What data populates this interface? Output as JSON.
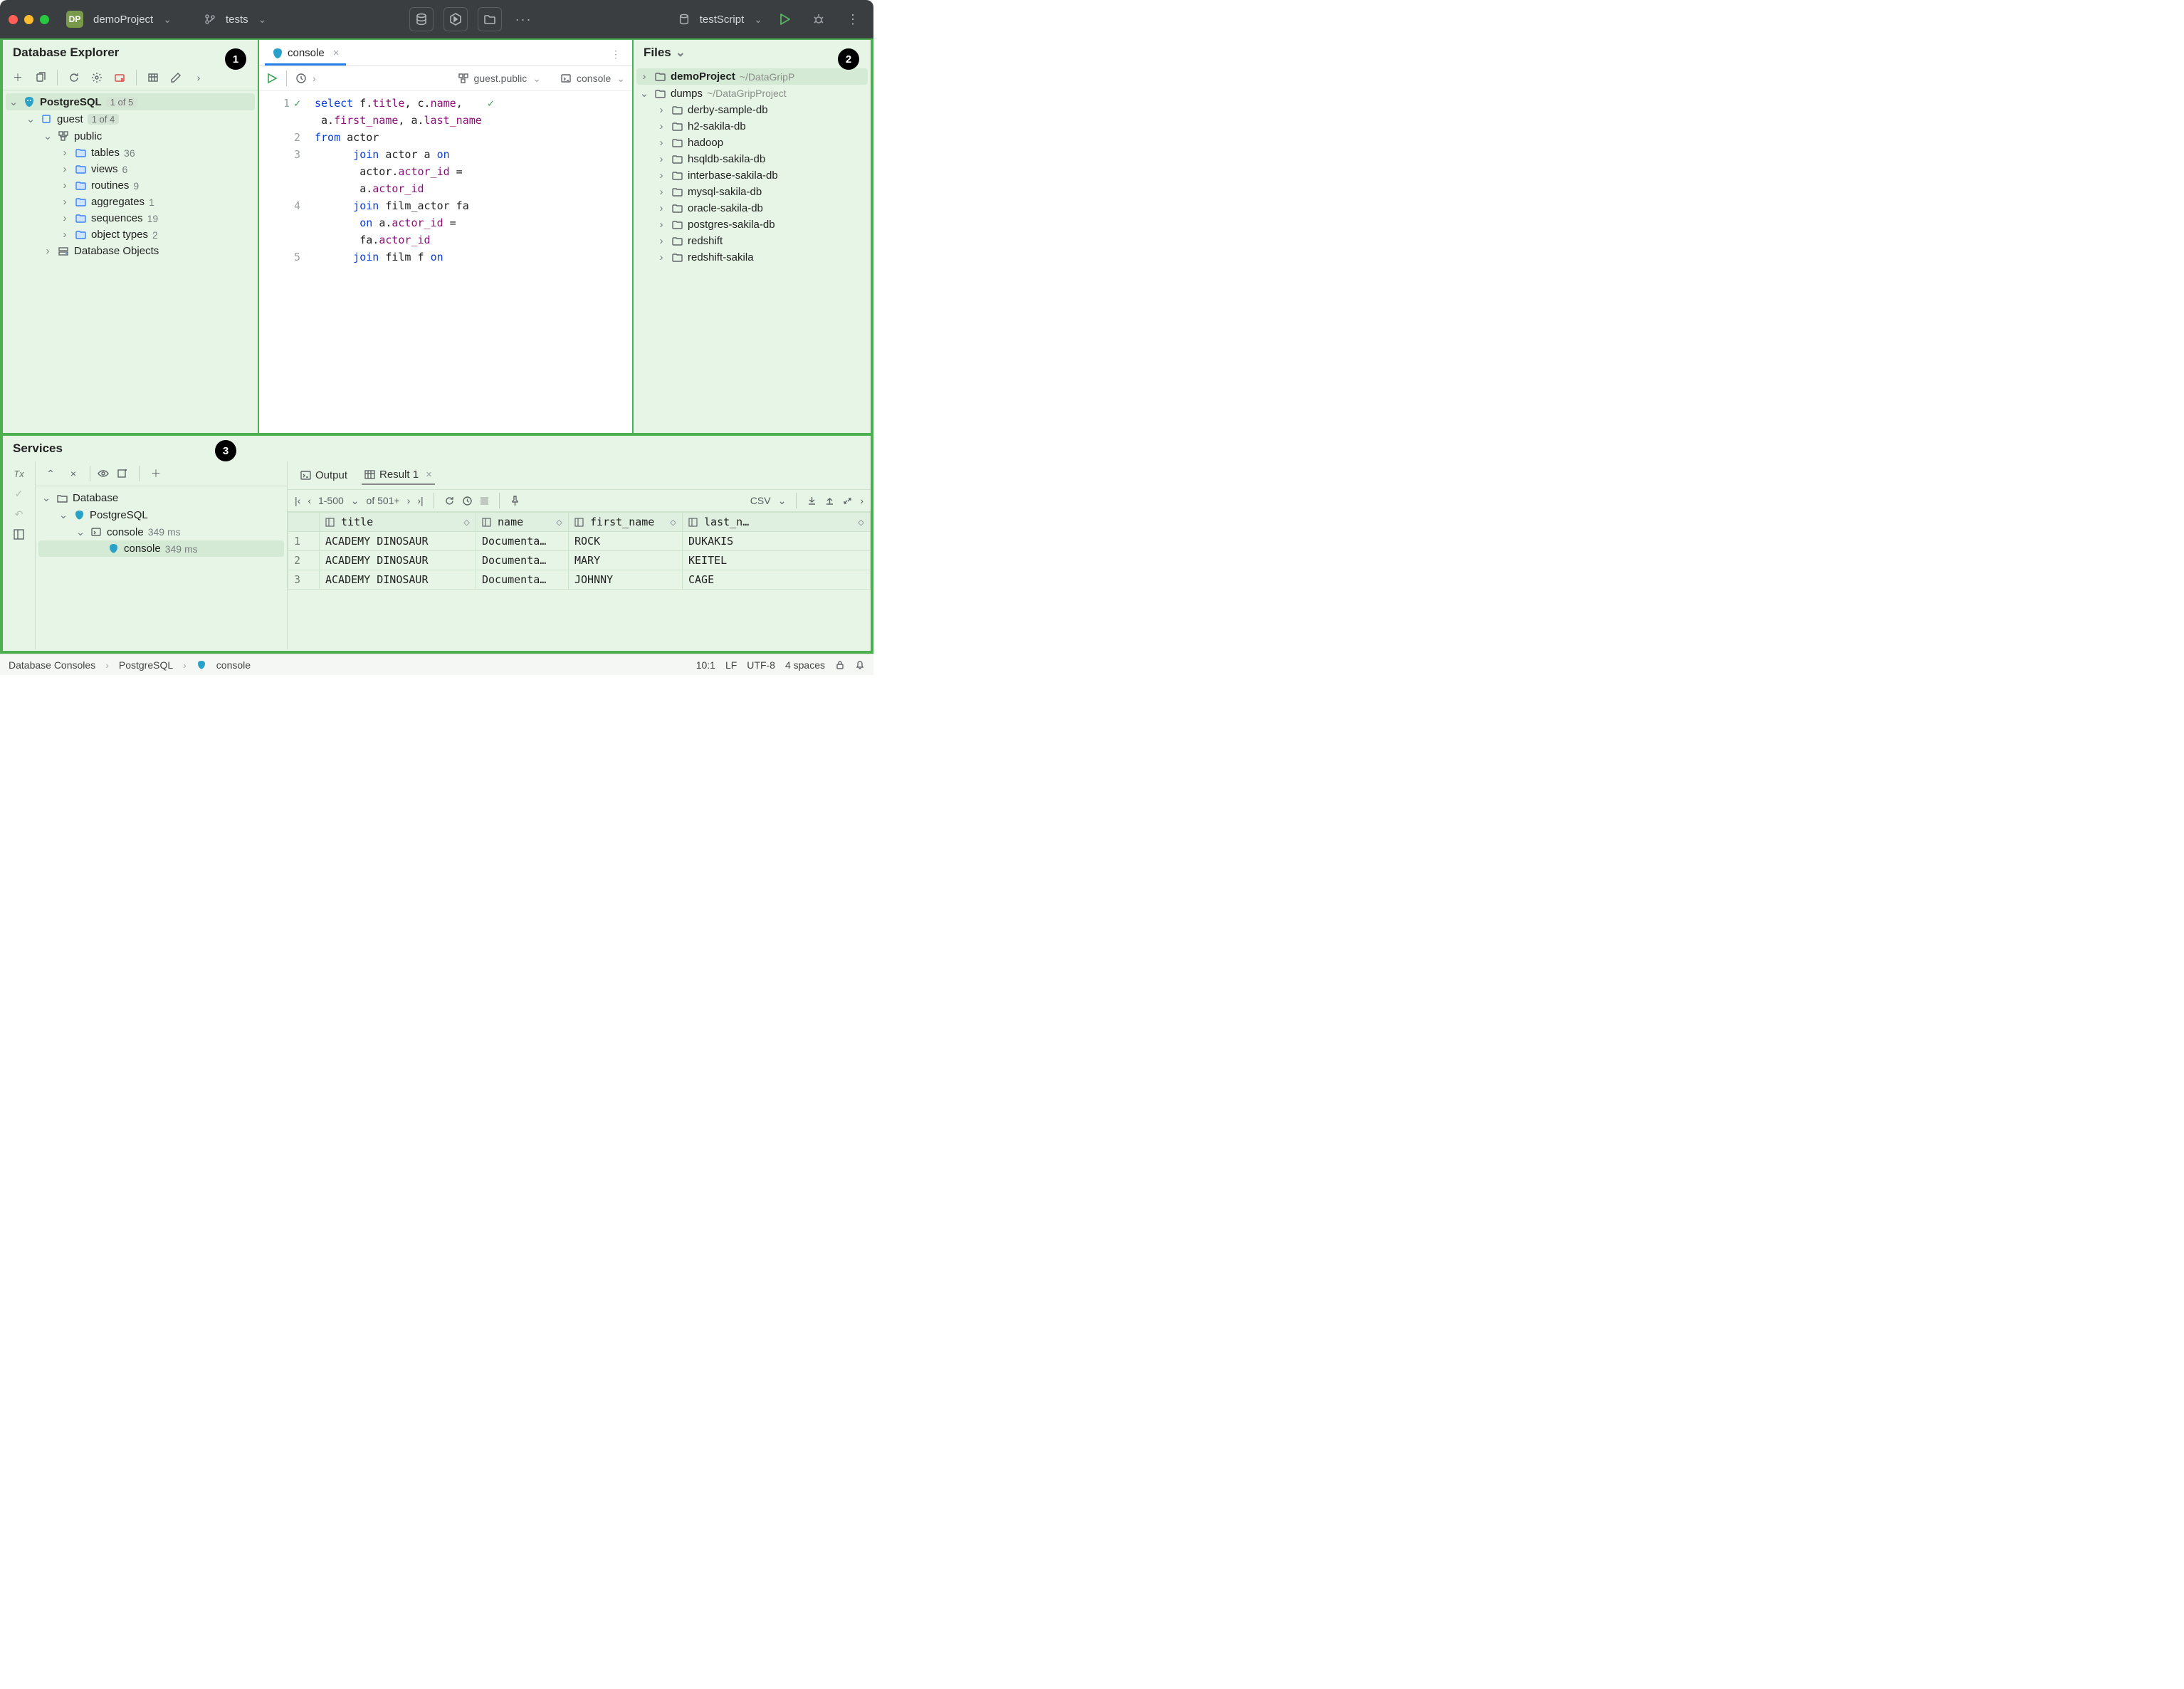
{
  "titlebar": {
    "project_badge": "DP",
    "project_name": "demoProject",
    "branch": "tests",
    "run_config": "testScript"
  },
  "callouts": {
    "db": "1",
    "files": "2",
    "services": "3"
  },
  "db_explorer": {
    "title": "Database Explorer",
    "datasource": "PostgreSQL",
    "datasource_count": "1 of 5",
    "database": "guest",
    "database_count": "1 of 4",
    "schema": "public",
    "nodes": [
      {
        "label": "tables",
        "count": "36"
      },
      {
        "label": "views",
        "count": "6"
      },
      {
        "label": "routines",
        "count": "9"
      },
      {
        "label": "aggregates",
        "count": "1"
      },
      {
        "label": "sequences",
        "count": "19"
      },
      {
        "label": "object types",
        "count": "2"
      }
    ],
    "db_objects": "Database Objects"
  },
  "editor": {
    "tab_label": "console",
    "schema_selector": "guest.public",
    "target_selector": "console",
    "code_lines": [
      {
        "n": "1",
        "txt": [
          "select ",
          "f",
          ".",
          "title",
          ", ",
          "c",
          ".",
          "name",
          ","
        ]
      },
      {
        "n": "",
        "txt": [
          " a",
          ".",
          "first_name",
          ", ",
          "a",
          ".",
          "last_name"
        ]
      },
      {
        "n": "2",
        "txt": [
          "from ",
          "actor"
        ]
      },
      {
        "n": "3",
        "txt": [
          "      join ",
          "actor a ",
          "on"
        ]
      },
      {
        "n": "",
        "txt": [
          "       actor",
          ".",
          "actor_id",
          " ="
        ]
      },
      {
        "n": "",
        "txt": [
          "       a",
          ".",
          "actor_id"
        ]
      },
      {
        "n": "4",
        "txt": [
          "      join ",
          "film_actor fa"
        ]
      },
      {
        "n": "",
        "txt": [
          "       on ",
          "a",
          ".",
          "actor_id",
          " ="
        ]
      },
      {
        "n": "",
        "txt": [
          "       fa",
          ".",
          "actor_id"
        ]
      },
      {
        "n": "5",
        "txt": [
          "      join ",
          "film f ",
          "on"
        ]
      }
    ]
  },
  "files": {
    "title": "Files",
    "root": {
      "label": "demoProject",
      "hint": "~/DataGripP"
    },
    "dumps": {
      "label": "dumps",
      "hint": "~/DataGripProject"
    },
    "items": [
      "derby-sample-db",
      "h2-sakila-db",
      "hadoop",
      "hsqldb-sakila-db",
      "interbase-sakila-db",
      "mysql-sakila-db",
      "oracle-sakila-db",
      "postgres-sakila-db",
      "redshift",
      "redshift-sakila"
    ]
  },
  "services": {
    "title": "Services",
    "tree": {
      "root": "Database",
      "ds": "PostgreSQL",
      "console": "console",
      "time": "349 ms"
    },
    "tabs": {
      "output": "Output",
      "result": "Result 1"
    },
    "pager": {
      "range": "1-500",
      "total": "of 501+"
    },
    "export": "CSV",
    "columns": [
      "title",
      "name",
      "first_name",
      "last_n…"
    ],
    "rows": [
      {
        "n": "1",
        "c": [
          "ACADEMY DINOSAUR",
          "Documenta…",
          "ROCK",
          "DUKAKIS"
        ]
      },
      {
        "n": "2",
        "c": [
          "ACADEMY DINOSAUR",
          "Documenta…",
          "MARY",
          "KEITEL"
        ]
      },
      {
        "n": "3",
        "c": [
          "ACADEMY DINOSAUR",
          "Documenta…",
          "JOHNNY",
          "CAGE"
        ]
      }
    ]
  },
  "statusbar": {
    "crumbs": [
      "Database Consoles",
      "PostgreSQL",
      "console"
    ],
    "pos": "10:1",
    "eol": "LF",
    "enc": "UTF-8",
    "indent": "4 spaces"
  }
}
